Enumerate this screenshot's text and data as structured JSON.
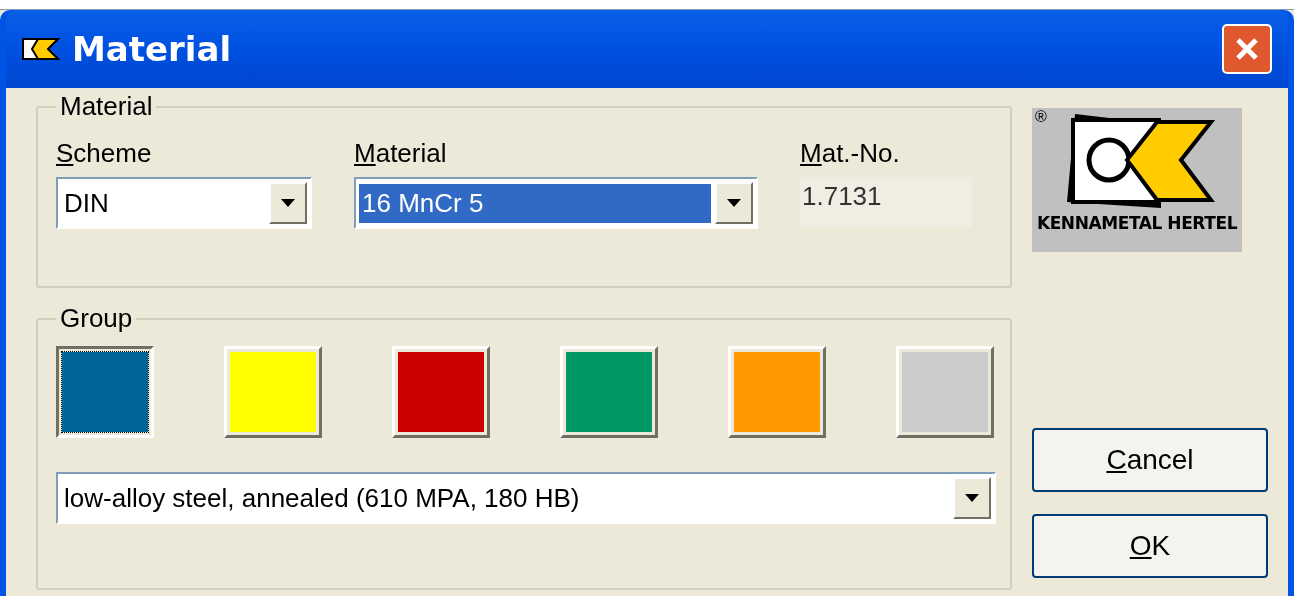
{
  "window": {
    "title": "Material"
  },
  "material_group": {
    "title": "Material",
    "scheme": {
      "label": "Scheme",
      "value": "DIN"
    },
    "material": {
      "label": "Material",
      "value": "16 MnCr 5"
    },
    "mat_no": {
      "label": "Mat.-No.",
      "value": "1.7131"
    }
  },
  "group": {
    "title": "Group",
    "swatches": [
      {
        "color": "#006699",
        "selected": true
      },
      {
        "color": "#ffff00",
        "selected": false
      },
      {
        "color": "#cc0000",
        "selected": false
      },
      {
        "color": "#009966",
        "selected": false
      },
      {
        "color": "#ff9900",
        "selected": false
      },
      {
        "color": "#cccccc",
        "selected": false
      }
    ],
    "description": {
      "value": "low-alloy steel, annealed (610 MPA, 180 HB)"
    }
  },
  "logo": {
    "mark": "®",
    "text": "KENNAMETAL HERTEL"
  },
  "buttons": [
    {
      "label": "Cancel"
    },
    {
      "label": "OK"
    }
  ]
}
